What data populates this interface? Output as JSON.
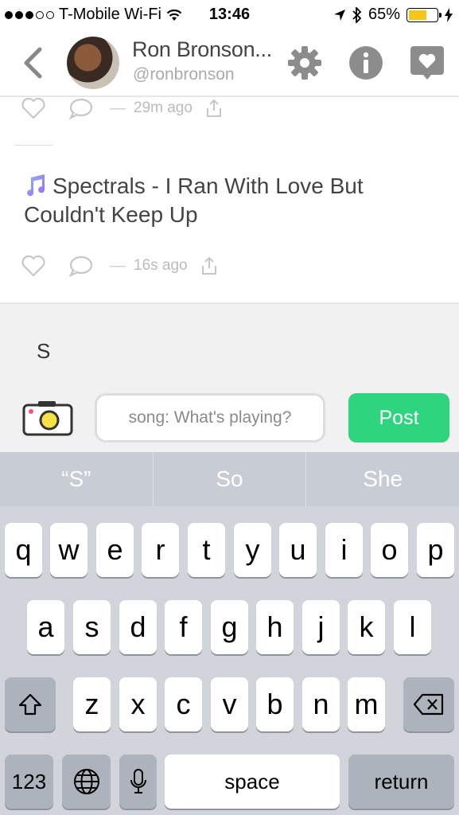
{
  "status_bar": {
    "carrier": "T-Mobile Wi-Fi",
    "time": "13:46",
    "battery": "65%",
    "battery_level": 0.65,
    "signal_dots_filled": 3,
    "signal_dots_total": 5
  },
  "header": {
    "display_name": "Ron Bronson...",
    "handle": "@ronbronson",
    "icons": [
      "back-chevron-icon",
      "gear-icon",
      "info-icon",
      "heart-icon"
    ]
  },
  "feed": {
    "posts": [
      {
        "time": "29m ago"
      },
      {
        "text": "Spectrals - I Ran With Love But Couldn't Keep Up",
        "icon": "music-note-icon",
        "time": "16s ago"
      }
    ],
    "dash": "—"
  },
  "compose": {
    "typed_text": "S",
    "input_placeholder": "song: What's playing?",
    "post_label": "Post"
  },
  "keyboard": {
    "suggestions": [
      "“S”",
      "So",
      "She"
    ],
    "row1": [
      "q",
      "w",
      "e",
      "r",
      "t",
      "y",
      "u",
      "i",
      "o",
      "p"
    ],
    "row2": [
      "a",
      "s",
      "d",
      "f",
      "g",
      "h",
      "j",
      "k",
      "l"
    ],
    "row3": [
      "z",
      "x",
      "c",
      "v",
      "b",
      "n",
      "m"
    ],
    "numbers_label": "123",
    "space_label": "space",
    "return_label": "return"
  },
  "colors": {
    "accent_green": "#2fd47f",
    "battery_yellow": "#f5c518",
    "icon_gray": "#c7c7c7"
  }
}
